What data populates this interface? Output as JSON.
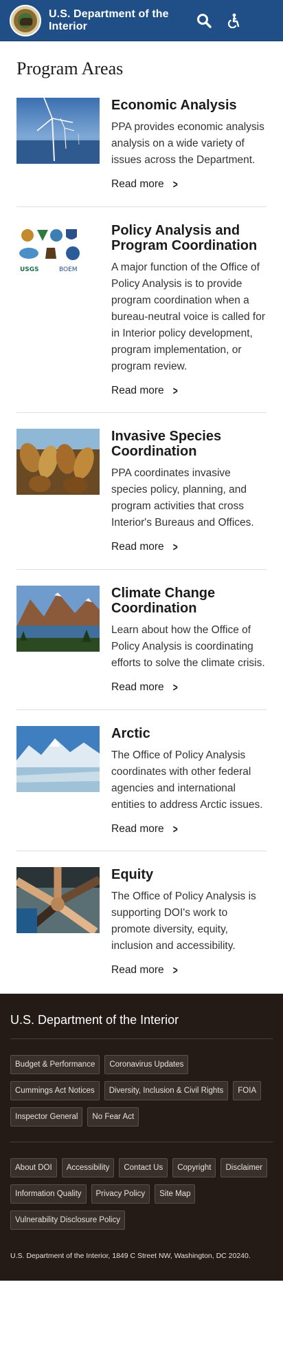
{
  "header": {
    "site_title": "U.S. Department of the Interior",
    "icons": [
      "seal-logo",
      "search-icon",
      "accessibility-icon",
      "menu-icon"
    ],
    "colors": {
      "bar": "#1f4f86"
    }
  },
  "main": {
    "title": "Program Areas",
    "cards": [
      {
        "title": "Economic Analysis",
        "text": "PPA provides economic analysis analysis on a wide variety of issues across the Department.",
        "link": "Read more",
        "image": "wind-turbines"
      },
      {
        "title": "Policy Analysis and Program Coordination",
        "text": "A major function of the Office of Policy Analysis is to provide program coordination when a bureau-neutral voice is called for in Interior policy development, program implementation, or program review.",
        "link": "Read more",
        "image": "bureau-logos",
        "logo_text": [
          "USGS",
          "BOEM"
        ]
      },
      {
        "title": "Invasive Species Coordination",
        "text": "PPA coordinates invasive species policy, planning, and program activities that cross Interior's Bureaus and Offices.",
        "link": "Read more",
        "image": "mussels"
      },
      {
        "title": "Climate Change Coordination",
        "text": "Learn about how the Office of Policy Analysis is coordinating efforts to solve the climate crisis.",
        "link": "Read more",
        "image": "mountain-lake"
      },
      {
        "title": "Arctic",
        "text": "The Office of Policy Analysis coordinates with other federal agencies and international entities to address Arctic issues.",
        "link": "Read more",
        "image": "glacier"
      },
      {
        "title": "Equity",
        "text": "The Office of Policy Analysis is supporting DOI's work to promote diversity, equity, inclusion and accessibility.",
        "link": "Read more",
        "image": "joined-hands"
      }
    ]
  },
  "footer": {
    "title": "U.S. Department of the Interior",
    "links_primary": [
      "Budget & Performance",
      "Coronavirus Updates",
      "Cummings Act Notices",
      "Diversity, Inclusion & Civil Rights",
      "FOIA",
      "Inspector General",
      "No Fear Act"
    ],
    "links_secondary": [
      "About DOI",
      "Accessibility",
      "Contact Us",
      "Copyright",
      "Disclaimer",
      "Information Quality",
      "Privacy Policy",
      "Site Map",
      "Vulnerability Disclosure Policy"
    ],
    "address": "U.S. Department of the Interior, 1849 C Street NW, Washington, DC 20240.",
    "colors": {
      "background": "#241a16",
      "pill": "#3a302b"
    }
  }
}
